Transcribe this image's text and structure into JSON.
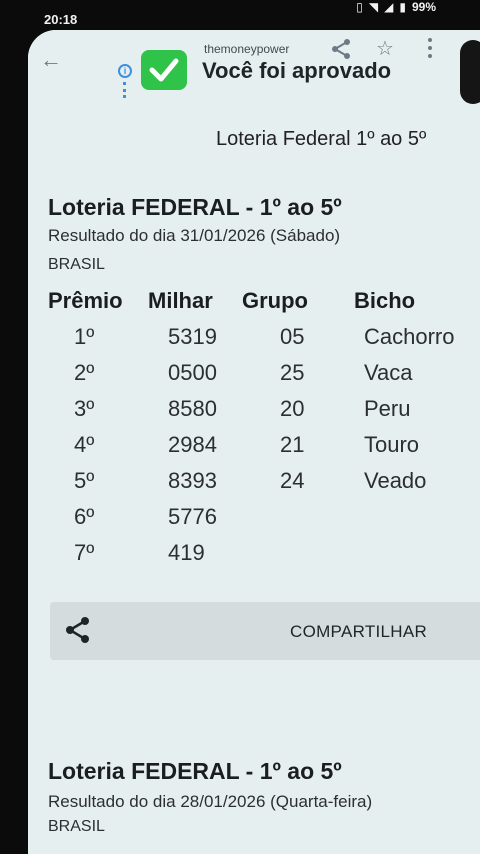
{
  "status_bar": {
    "time": "20:18",
    "battery": "99%"
  },
  "app_bar": {
    "site_name": "themoneypower",
    "title": "Você foi aprovado"
  },
  "page": {
    "heading": "Loteria Federal 1º ao 5º"
  },
  "results": [
    {
      "title": "Loteria FEDERAL - 1º ao 5º",
      "date": "Resultado do dia 31/01/2026 (Sábado)",
      "country": "BRASIL",
      "columns": [
        "Prêmio",
        "Milhar",
        "Grupo",
        "Bicho"
      ],
      "rows": [
        {
          "premio": "1º",
          "milhar": "5319",
          "grupo": "05",
          "bicho": "Cachorro"
        },
        {
          "premio": "2º",
          "milhar": "0500",
          "grupo": "25",
          "bicho": "Vaca"
        },
        {
          "premio": "3º",
          "milhar": "8580",
          "grupo": "20",
          "bicho": "Peru"
        },
        {
          "premio": "4º",
          "milhar": "2984",
          "grupo": "21",
          "bicho": "Touro"
        },
        {
          "premio": "5º",
          "milhar": "8393",
          "grupo": "24",
          "bicho": "Veado"
        },
        {
          "premio": "6º",
          "milhar": "5776",
          "grupo": "",
          "bicho": ""
        },
        {
          "premio": "7º",
          "milhar": "419",
          "grupo": "",
          "bicho": ""
        }
      ],
      "share_label": "COMPARTILHAR"
    },
    {
      "title": "Loteria FEDERAL - 1º ao 5º",
      "date": "Resultado do dia 28/01/2026 (Quarta-feira)",
      "country": "BRASIL"
    }
  ],
  "colors": {
    "screen_bg": "#e6efef",
    "check_badge": "#2fc34a",
    "accent_blue": "#3d8fe0",
    "share_bar_bg": "#d4dcde"
  }
}
